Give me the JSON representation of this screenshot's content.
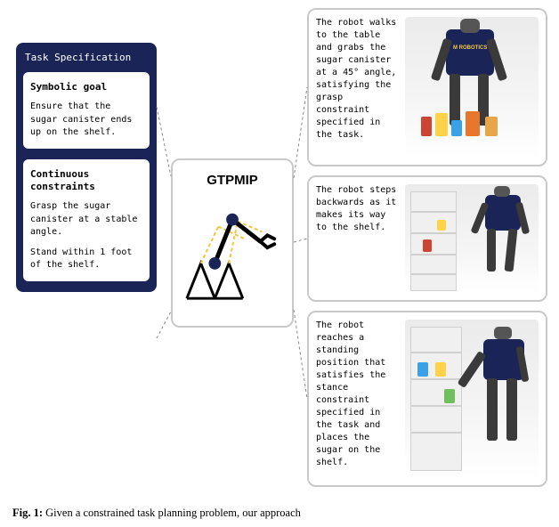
{
  "taskSpec": {
    "title": "Task Specification",
    "symbolic": {
      "title": "Symbolic goal",
      "text": "Ensure that the sugar canister ends up on the shelf."
    },
    "continuous": {
      "title": "Continuous constraints",
      "text1": "Grasp the sugar canister at a stable angle.",
      "text2": "Stand within 1 foot of the shelf."
    }
  },
  "center": {
    "title": "GTPMIP"
  },
  "right": {
    "r1": "The robot walks to the table and grabs the sugar canister at a 45° angle, satisfying the grasp constraint specified in the task.",
    "r2": "The robot steps backwards as it makes its way to the shelf.",
    "r3": "The robot reaches a standing position that satisfies the stance constraint specified in the task and places the sugar on the shelf."
  },
  "caption": {
    "label": "Fig. 1:",
    "text": " Given a constrained task planning problem, our approach"
  },
  "robotBadge": "M ROBOTICS"
}
